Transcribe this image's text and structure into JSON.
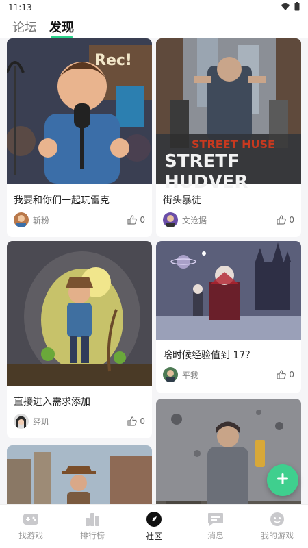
{
  "status_bar": {
    "time": "11:13"
  },
  "top_tabs": [
    {
      "label": "论坛",
      "active": false
    },
    {
      "label": "发现",
      "active": true
    }
  ],
  "cards": [
    {
      "title": "我要和你们一起玩雷克",
      "author": "靳粉",
      "likes": "0",
      "image_text": "Rec!"
    },
    {
      "title": "街头暴徒",
      "author": "文沧据",
      "likes": "0",
      "image_text_1": "STREET HUSE",
      "image_text_2": "STRETF HUDVER"
    },
    {
      "title": "直接进入需求添加",
      "author": "经玑",
      "likes": "0"
    },
    {
      "title": "啥时候经验值到 17？",
      "author": "平我",
      "likes": "0"
    },
    {
      "title": "",
      "author": "",
      "likes": ""
    },
    {
      "title": "",
      "author": "",
      "likes": ""
    }
  ],
  "bottom_nav": [
    {
      "label": "找游戏",
      "icon": "gamepad-icon",
      "active": false
    },
    {
      "label": "排行榜",
      "icon": "ranking-icon",
      "active": false
    },
    {
      "label": "社区",
      "icon": "compass-icon",
      "active": true
    },
    {
      "label": "消息",
      "icon": "message-icon",
      "active": false
    },
    {
      "label": "我的游戏",
      "icon": "profile-game-icon",
      "active": false
    }
  ],
  "fab": {
    "icon": "plus-icon"
  },
  "colors": {
    "accent": "#3fcf8e",
    "tab_underline": "#2bd38a"
  }
}
